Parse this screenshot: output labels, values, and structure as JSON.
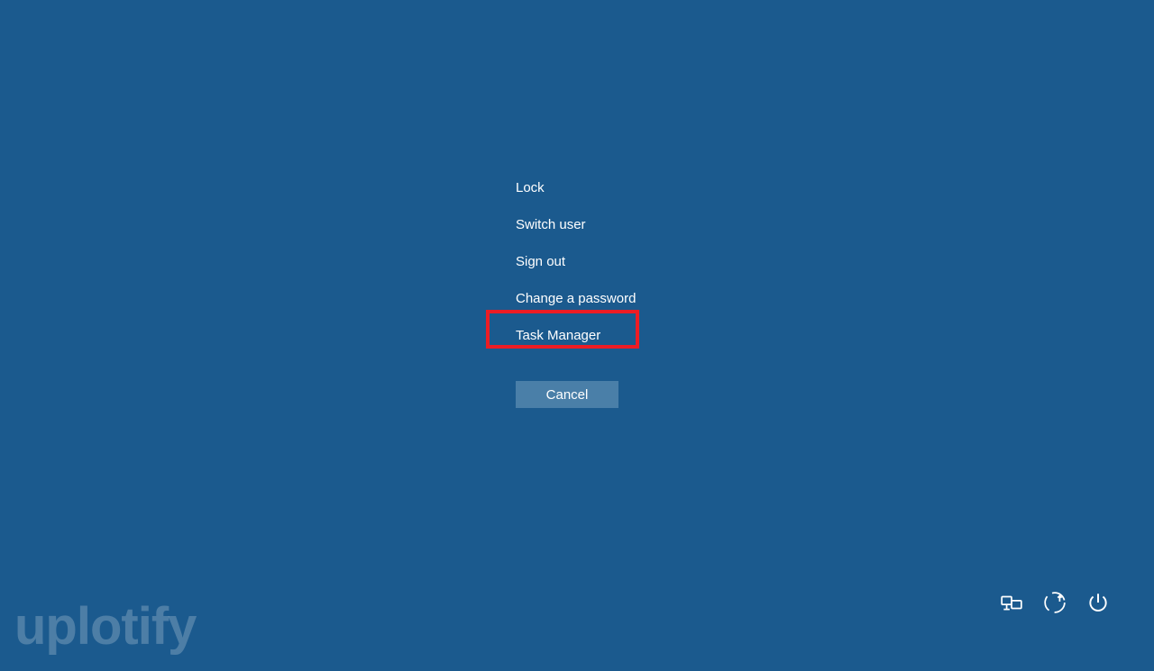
{
  "menu": {
    "items": [
      {
        "label": "Lock"
      },
      {
        "label": "Switch user"
      },
      {
        "label": "Sign out"
      },
      {
        "label": "Change a password"
      },
      {
        "label": "Task Manager"
      }
    ]
  },
  "cancel": {
    "label": "Cancel"
  },
  "watermark": {
    "text": "uplotify"
  },
  "highlight": {
    "target_index": 4
  },
  "colors": {
    "background": "#1b5a8e",
    "button": "#4a7fa8",
    "highlight_border": "#ed1c24"
  }
}
